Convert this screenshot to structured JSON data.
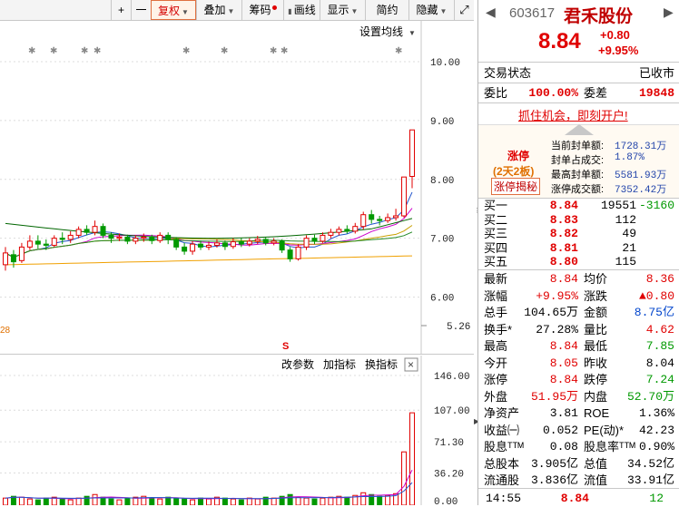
{
  "toolbar": {
    "plus": "+",
    "minus": "一",
    "items": [
      "复权",
      "叠加",
      "筹码",
      "画线",
      "显示",
      "简约",
      "隐藏"
    ],
    "expand": "⤢"
  },
  "price_chart": {
    "setting_label": "设置均线",
    "yticks": [
      "10.00",
      "9.00",
      "8.00",
      "7.00",
      "6.00",
      "5.26"
    ],
    "left_label": "28",
    "marker": "S"
  },
  "volume_chart": {
    "params_label": "改参数",
    "add_indicator": "加指标",
    "switch_indicator": "换指标",
    "close": "×",
    "yticks": [
      "146.00",
      "107.00",
      "71.30",
      "36.20",
      "0.00"
    ]
  },
  "stock": {
    "code": "603617",
    "name": "君禾股份",
    "price": "8.84",
    "change": "+0.80",
    "change_pct": "+9.95%"
  },
  "status": {
    "label": "交易状态",
    "value": "已收市"
  },
  "ratio": {
    "wb_label": "委比",
    "wb_value": "100.00%",
    "wc_label": "委差",
    "wc_value": "19848"
  },
  "promo": "抓住机会，即刻开户!",
  "limit_up": {
    "title": "涨停",
    "days": "(2天2板)",
    "reveal": "涨停揭秘",
    "stats": [
      {
        "label": "当前封单额:",
        "value": "1728.31万"
      },
      {
        "label": "封单占成交:",
        "value": "1.87%"
      },
      {
        "label": "最高封单额:",
        "value": "5581.93万"
      },
      {
        "label": "涨停成交额:",
        "value": "7352.42万"
      }
    ]
  },
  "order_book": [
    {
      "label": "买一",
      "price": "8.84",
      "vol": "19551",
      "chg": "-3160"
    },
    {
      "label": "买二",
      "price": "8.83",
      "vol": "112",
      "chg": ""
    },
    {
      "label": "买三",
      "price": "8.82",
      "vol": "49",
      "chg": ""
    },
    {
      "label": "买四",
      "price": "8.81",
      "vol": "21",
      "chg": ""
    },
    {
      "label": "买五",
      "price": "8.80",
      "vol": "115",
      "chg": ""
    }
  ],
  "quote_rows": [
    {
      "l1": "最新",
      "v1": "8.84",
      "c1": "red",
      "l2": "均价",
      "v2": "8.36",
      "c2": "red"
    },
    {
      "l1": "涨幅",
      "v1": "+9.95%",
      "c1": "red",
      "l2": "涨跌",
      "v2": "▲0.80",
      "c2": "red"
    },
    {
      "l1": "总手",
      "v1": "104.65万",
      "c1": "black",
      "l2": "金额",
      "v2": "8.75亿",
      "c2": "blue"
    },
    {
      "l1": "换手*",
      "v1": "27.28%",
      "c1": "black",
      "l2": "量比",
      "v2": "4.62",
      "c2": "red"
    },
    {
      "l1": "最高",
      "v1": "8.84",
      "c1": "red",
      "l2": "最低",
      "v2": "7.85",
      "c2": "green"
    },
    {
      "l1": "今开",
      "v1": "8.05",
      "c1": "red",
      "l2": "昨收",
      "v2": "8.04",
      "c2": "black"
    },
    {
      "l1": "涨停",
      "v1": "8.84",
      "c1": "red",
      "l2": "跌停",
      "v2": "7.24",
      "c2": "green"
    },
    {
      "l1": "外盘",
      "v1": "51.95万",
      "c1": "red",
      "l2": "内盘",
      "v2": "52.70万",
      "c2": "green"
    },
    {
      "l1": "净资产",
      "v1": "3.81",
      "c1": "black",
      "l2": "ROE",
      "v2": "1.36%",
      "c2": "black"
    },
    {
      "l1": "收益㈠",
      "v1": "0.052",
      "c1": "black",
      "l2": "PE(动)*",
      "v2": "42.23",
      "c2": "black"
    },
    {
      "l1": "股息ᵀᵀᴹ",
      "v1": "0.08",
      "c1": "black",
      "l2": "股息率ᵀᵀᴹ",
      "v2": "0.90%",
      "c2": "black"
    },
    {
      "l1": "总股本",
      "v1": "3.905亿",
      "c1": "black",
      "l2": "总值",
      "v2": "34.52亿",
      "c2": "black"
    },
    {
      "l1": "流通股",
      "v1": "3.836亿",
      "c1": "black",
      "l2": "流值",
      "v2": "33.91亿",
      "c2": "black"
    }
  ],
  "tick": {
    "time": "14:55",
    "price": "8.84",
    "vol": "12"
  },
  "chart_data": {
    "type": "candlestick",
    "ylim": [
      5.26,
      10.0
    ],
    "candles": [
      {
        "o": 6.55,
        "c": 6.75,
        "h": 6.85,
        "l": 6.45
      },
      {
        "o": 6.72,
        "c": 6.6,
        "h": 6.8,
        "l": 6.5
      },
      {
        "o": 6.62,
        "c": 6.85,
        "h": 6.92,
        "l": 6.58
      },
      {
        "o": 6.85,
        "c": 6.95,
        "h": 7.05,
        "l": 6.8
      },
      {
        "o": 6.95,
        "c": 6.9,
        "h": 7.05,
        "l": 6.82
      },
      {
        "o": 6.9,
        "c": 6.88,
        "h": 6.98,
        "l": 6.8
      },
      {
        "o": 6.88,
        "c": 7.0,
        "h": 7.05,
        "l": 6.85
      },
      {
        "o": 7.0,
        "c": 6.98,
        "h": 7.1,
        "l": 6.9
      },
      {
        "o": 6.98,
        "c": 7.05,
        "h": 7.12,
        "l": 6.92
      },
      {
        "o": 7.05,
        "c": 7.15,
        "h": 7.2,
        "l": 7.0
      },
      {
        "o": 7.15,
        "c": 7.1,
        "h": 7.22,
        "l": 7.05
      },
      {
        "o": 7.1,
        "c": 7.2,
        "h": 7.3,
        "l": 7.05
      },
      {
        "o": 7.2,
        "c": 7.05,
        "h": 7.25,
        "l": 7.0
      },
      {
        "o": 7.05,
        "c": 7.0,
        "h": 7.1,
        "l": 6.92
      },
      {
        "o": 7.0,
        "c": 7.02,
        "h": 7.08,
        "l": 6.95
      },
      {
        "o": 7.02,
        "c": 6.95,
        "h": 7.06,
        "l": 6.9
      },
      {
        "o": 6.95,
        "c": 7.0,
        "h": 7.05,
        "l": 6.9
      },
      {
        "o": 7.0,
        "c": 7.02,
        "h": 7.08,
        "l": 6.94
      },
      {
        "o": 7.02,
        "c": 6.96,
        "h": 7.06,
        "l": 6.9
      },
      {
        "o": 6.96,
        "c": 7.05,
        "h": 7.1,
        "l": 6.92
      },
      {
        "o": 7.05,
        "c": 6.98,
        "h": 7.1,
        "l": 6.9
      },
      {
        "o": 6.98,
        "c": 6.85,
        "h": 7.02,
        "l": 6.8
      },
      {
        "o": 6.85,
        "c": 6.78,
        "h": 6.92,
        "l": 6.72
      },
      {
        "o": 6.78,
        "c": 6.9,
        "h": 6.95,
        "l": 6.72
      },
      {
        "o": 6.9,
        "c": 6.85,
        "h": 6.96,
        "l": 6.8
      },
      {
        "o": 6.85,
        "c": 6.88,
        "h": 6.94,
        "l": 6.8
      },
      {
        "o": 6.88,
        "c": 6.92,
        "h": 6.98,
        "l": 6.84
      },
      {
        "o": 6.92,
        "c": 6.86,
        "h": 6.96,
        "l": 6.8
      },
      {
        "o": 6.86,
        "c": 6.94,
        "h": 7.0,
        "l": 6.82
      },
      {
        "o": 6.94,
        "c": 6.9,
        "h": 7.0,
        "l": 6.85
      },
      {
        "o": 6.9,
        "c": 6.95,
        "h": 7.0,
        "l": 6.86
      },
      {
        "o": 6.95,
        "c": 6.98,
        "h": 7.04,
        "l": 6.9
      },
      {
        "o": 6.98,
        "c": 6.92,
        "h": 7.02,
        "l": 6.88
      },
      {
        "o": 6.92,
        "c": 6.95,
        "h": 7.0,
        "l": 6.88
      },
      {
        "o": 6.95,
        "c": 6.8,
        "h": 6.98,
        "l": 6.75
      },
      {
        "o": 6.8,
        "c": 6.65,
        "h": 6.85,
        "l": 6.6
      },
      {
        "o": 6.65,
        "c": 6.85,
        "h": 6.9,
        "l": 6.62
      },
      {
        "o": 6.85,
        "c": 7.0,
        "h": 7.05,
        "l": 6.8
      },
      {
        "o": 7.0,
        "c": 6.95,
        "h": 7.06,
        "l": 6.9
      },
      {
        "o": 6.95,
        "c": 7.05,
        "h": 7.1,
        "l": 6.92
      },
      {
        "o": 7.05,
        "c": 7.1,
        "h": 7.16,
        "l": 7.0
      },
      {
        "o": 7.1,
        "c": 7.15,
        "h": 7.2,
        "l": 7.05
      },
      {
        "o": 7.15,
        "c": 7.12,
        "h": 7.22,
        "l": 7.08
      },
      {
        "o": 7.12,
        "c": 7.2,
        "h": 7.26,
        "l": 7.08
      },
      {
        "o": 7.2,
        "c": 7.4,
        "h": 7.45,
        "l": 7.15
      },
      {
        "o": 7.4,
        "c": 7.32,
        "h": 7.48,
        "l": 7.25
      },
      {
        "o": 7.32,
        "c": 7.3,
        "h": 7.38,
        "l": 7.22
      },
      {
        "o": 7.3,
        "c": 7.35,
        "h": 7.42,
        "l": 7.26
      },
      {
        "o": 7.35,
        "c": 7.38,
        "h": 7.5,
        "l": 7.3
      },
      {
        "o": 7.38,
        "c": 8.04,
        "h": 8.04,
        "l": 7.35
      },
      {
        "o": 8.05,
        "c": 8.84,
        "h": 8.84,
        "l": 7.85
      }
    ],
    "volume_ylim": [
      0,
      146
    ],
    "volumes": [
      8,
      10,
      9,
      7,
      6,
      8,
      9,
      7,
      6,
      8,
      10,
      12,
      9,
      7,
      6,
      8,
      9,
      10,
      8,
      7,
      9,
      8,
      7,
      6,
      8,
      7,
      9,
      8,
      7,
      6,
      8,
      7,
      9,
      8,
      10,
      12,
      9,
      8,
      7,
      8,
      9,
      10,
      9,
      11,
      14,
      12,
      10,
      11,
      13,
      60,
      104
    ]
  }
}
